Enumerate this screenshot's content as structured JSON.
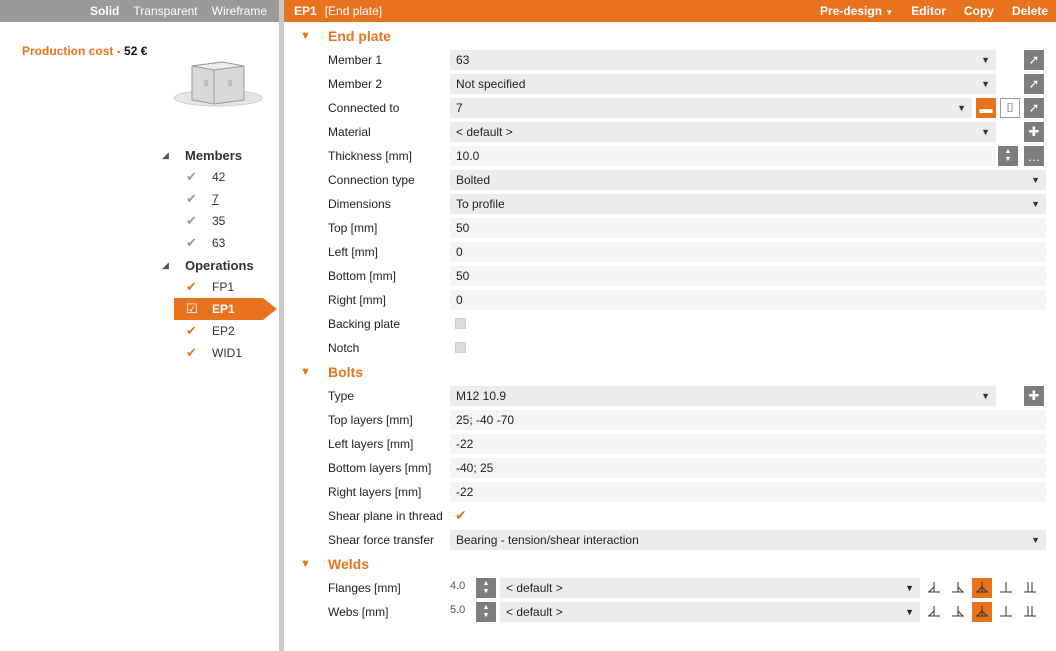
{
  "view_modes": [
    "Solid",
    "Transparent",
    "Wireframe"
  ],
  "production_cost": {
    "label": "Production cost",
    "separator": "-",
    "value": "52 €"
  },
  "tree": {
    "members_label": "Members",
    "members": [
      "42",
      "7",
      "35",
      "63"
    ],
    "operations_label": "Operations",
    "operations": [
      "FP1",
      "EP1",
      "EP2",
      "WID1"
    ]
  },
  "titlebar": {
    "id": "EP1",
    "name": "[End plate]",
    "predesign": "Pre-design",
    "editor": "Editor",
    "copy": "Copy",
    "delete": "Delete"
  },
  "end_plate": {
    "title": "End plate",
    "member1": {
      "label": "Member 1",
      "value": "63"
    },
    "member2": {
      "label": "Member 2",
      "value": "Not specified"
    },
    "connected_to": {
      "label": "Connected to",
      "value": "7"
    },
    "material": {
      "label": "Material",
      "value": "< default >"
    },
    "thickness": {
      "label": "Thickness [mm]",
      "value": "10.0"
    },
    "connection_type": {
      "label": "Connection type",
      "value": "Bolted"
    },
    "dimensions": {
      "label": "Dimensions",
      "value": "To profile"
    },
    "top": {
      "label": "Top [mm]",
      "value": "50"
    },
    "left": {
      "label": "Left [mm]",
      "value": "0"
    },
    "bottom": {
      "label": "Bottom [mm]",
      "value": "50"
    },
    "right": {
      "label": "Right [mm]",
      "value": "0"
    },
    "backing_plate": {
      "label": "Backing plate"
    },
    "notch": {
      "label": "Notch"
    }
  },
  "bolts": {
    "title": "Bolts",
    "type": {
      "label": "Type",
      "value": "M12 10.9"
    },
    "top_layers": {
      "label": "Top layers [mm]",
      "value": "25; -40 -70"
    },
    "left_layers": {
      "label": "Left layers [mm]",
      "value": "-22"
    },
    "bottom_layers": {
      "label": "Bottom layers [mm]",
      "value": "-40; 25"
    },
    "right_layers": {
      "label": "Right layers [mm]",
      "value": "-22"
    },
    "shear_plane": {
      "label": "Shear plane in thread"
    },
    "shear_force": {
      "label": "Shear force transfer",
      "value": "Bearing - tension/shear interaction"
    }
  },
  "welds": {
    "title": "Welds",
    "flanges": {
      "label": "Flanges [mm]",
      "size": "4.0",
      "value": "< default >"
    },
    "webs": {
      "label": "Webs [mm]",
      "size": "5.0",
      "value": "< default >"
    }
  },
  "colors": {
    "accent": "#e8731e",
    "toolbar_grey": "#9a9a9a",
    "button_grey": "#7e7e7e"
  }
}
